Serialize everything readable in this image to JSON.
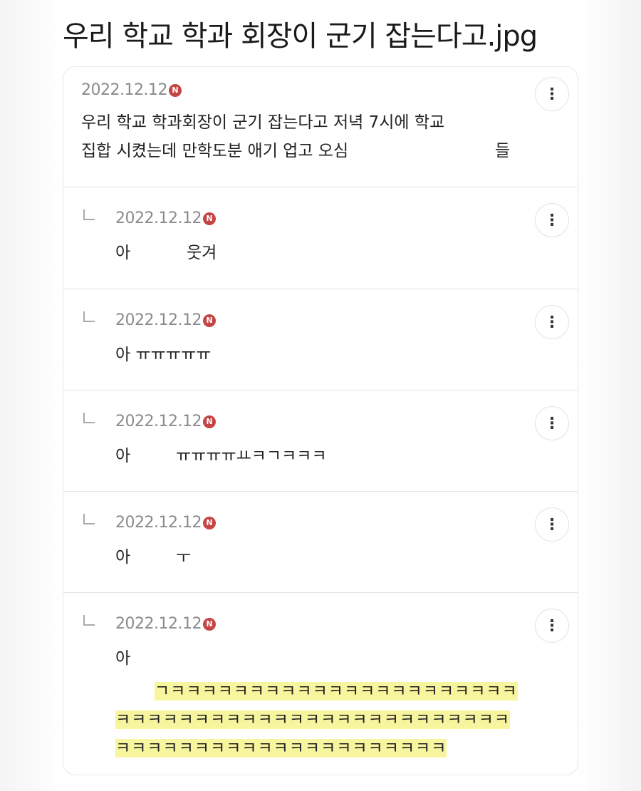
{
  "title": "우리 학교 학과 회장이 군기 잡는다고.jpg",
  "post": {
    "date": "2022.12.12",
    "badge": "N",
    "line1": "우리 학교 학과회장이 군기 잡는다고 저녁 7시에 학교",
    "line2": "집합 시켰는데 만학도분 애기 업고 오심",
    "line2_tail": "들"
  },
  "more_icon": "⋮",
  "comments": [
    {
      "date": "2022.12.12",
      "text": "아",
      "text2": "웃겨"
    },
    {
      "date": "2022.12.12",
      "text": "아 ㅠㅠㅠㅠㅠ"
    },
    {
      "date": "2022.12.12",
      "text": "아",
      "text2": "ㅠㅠㅠㅠㅛㅋㄱㅋㅋㅋ"
    },
    {
      "date": "2022.12.12",
      "text": "아",
      "text2": "ㅜ"
    },
    {
      "date": "2022.12.12",
      "text": "아",
      "highlight": [
        "ㄱㅋㅋㅋㅋㅋㅋㅋㅋㅋㅋㅋㅋㅋㅋㅋㅋㅋㅋㅋㅋㅋㅋ",
        "ㅋㅋㅋㅋㅋㅋㅋㅋㅋㅋㅋㅋㅋㅋㅋㅋㅋㅋㅋㅋㅋㅋㅋㅋㅋ",
        "ㅋㅋㅋㅋㅋㅋㅋㅋㅋㅋㅋㅋㅋㅋㅋㅋㅋㅋㅋㅋㅋ"
      ]
    }
  ],
  "colors": {
    "badge": "#c54545",
    "highlight": "#f8f59f"
  }
}
